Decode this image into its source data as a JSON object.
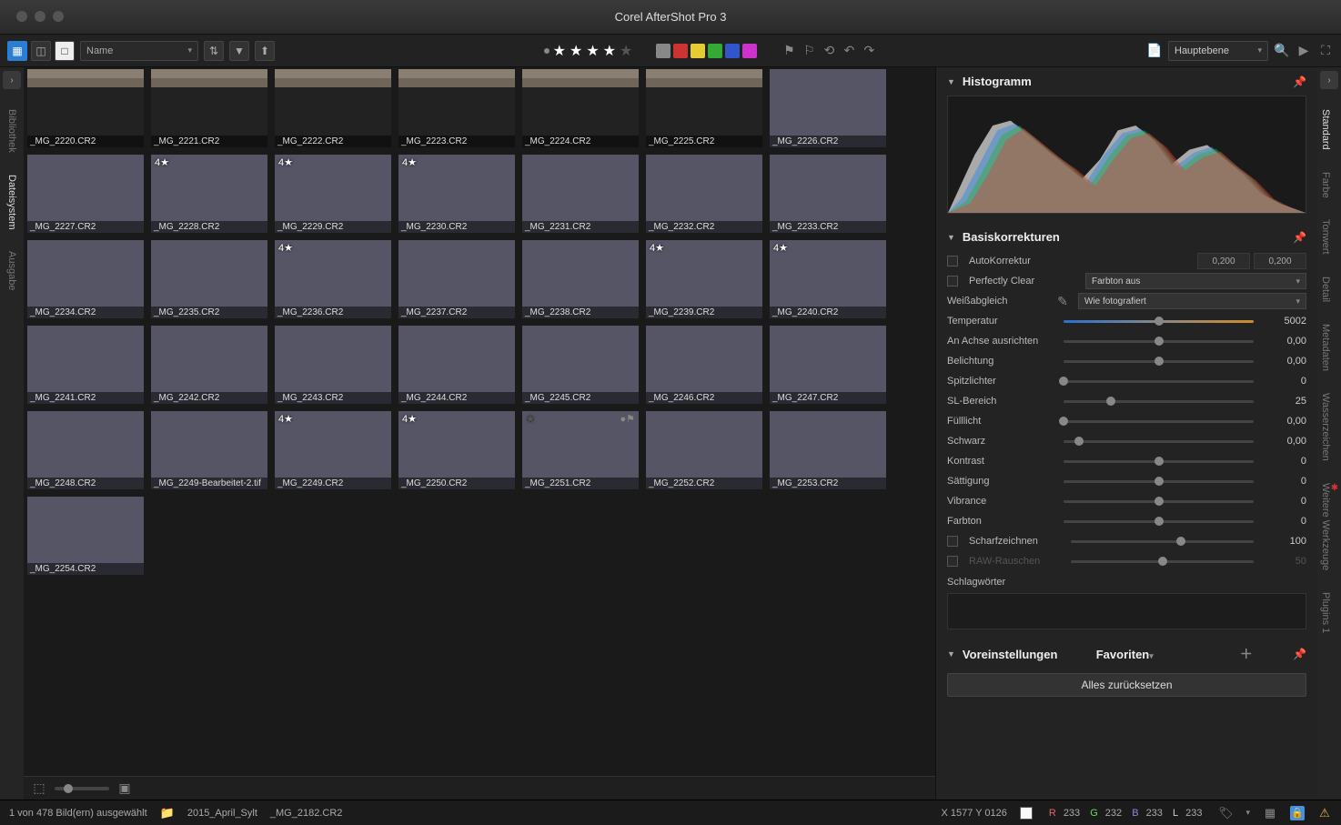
{
  "app": {
    "title": "Corel AfterShot Pro 3"
  },
  "toolbar": {
    "sort_by": "Name",
    "layer": "Hauptebene",
    "label_colors": [
      "#888888",
      "#cc3333",
      "#e6cc33",
      "#33aa33",
      "#3355cc",
      "#cc33cc"
    ]
  },
  "left_tabs": [
    "Bibliothek",
    "Dateisystem",
    "Ausgabe"
  ],
  "left_active": 1,
  "right_tabs": [
    "Standard",
    "Farbe",
    "Tonwert",
    "Detail",
    "Metadaten",
    "Wasserzeichen",
    "Weitere Werkzeuge",
    "Plugins 1"
  ],
  "right_active": 0,
  "thumbnails": {
    "row0": [
      {
        "fn": "_MG_2220.CR2"
      },
      {
        "fn": "_MG_2221.CR2"
      },
      {
        "fn": "_MG_2222.CR2"
      },
      {
        "fn": "_MG_2223.CR2"
      },
      {
        "fn": "_MG_2224.CR2"
      },
      {
        "fn": "_MG_2225.CR2"
      }
    ],
    "rows": [
      [
        {
          "fn": "_MG_2226.CR2",
          "cls": "imgsky1"
        },
        {
          "fn": "_MG_2227.CR2",
          "cls": "imgsky1"
        },
        {
          "fn": "_MG_2228.CR2",
          "rating": "4★",
          "cls": "imgsky1"
        },
        {
          "fn": "_MG_2229.CR2",
          "rating": "4★",
          "cls": "imgsky1"
        },
        {
          "fn": "_MG_2230.CR2",
          "rating": "4★",
          "cls": "imgsky1"
        },
        {
          "fn": "_MG_2231.CR2",
          "cls": "imgsky1"
        }
      ],
      [
        {
          "fn": "_MG_2232.CR2",
          "cls": "imgsky2"
        },
        {
          "fn": "_MG_2233.CR2",
          "cls": "imgsky2"
        },
        {
          "fn": "_MG_2234.CR2",
          "cls": "imgsky2"
        },
        {
          "fn": "_MG_2235.CR2",
          "cls": "imgsky2"
        },
        {
          "fn": "_MG_2236.CR2",
          "rating": "4★",
          "cls": "imgsky2"
        },
        {
          "fn": "_MG_2237.CR2",
          "cls": "imgsky2"
        }
      ],
      [
        {
          "fn": "_MG_2238.CR2",
          "cls": "imgsky3"
        },
        {
          "fn": "_MG_2239.CR2",
          "rating": "4★",
          "cls": "imgsky3"
        },
        {
          "fn": "_MG_2240.CR2",
          "rating": "4★",
          "cls": "imgsky3"
        },
        {
          "fn": "_MG_2241.CR2",
          "cls": "imgsky3"
        },
        {
          "fn": "_MG_2242.CR2",
          "cls": "imgsky3"
        },
        {
          "fn": "_MG_2243.CR2",
          "cls": "imgsky3"
        }
      ],
      [
        {
          "fn": "_MG_2244.CR2",
          "cls": "imgsky4"
        },
        {
          "fn": "_MG_2245.CR2",
          "cls": "imgsky4"
        },
        {
          "fn": "_MG_2246.CR2",
          "cls": "imgsky4"
        },
        {
          "fn": "_MG_2247.CR2",
          "cls": "imgsky4"
        },
        {
          "fn": "_MG_2248.CR2",
          "cls": "imgsky4"
        },
        {
          "fn": "_MG_2249-Bearbeitet-2.tif",
          "cls": "imgsky4"
        }
      ],
      [
        {
          "fn": "_MG_2249.CR2",
          "rating": "4★",
          "cls": "imgsky5"
        },
        {
          "fn": "_MG_2250.CR2",
          "rating": "4★",
          "cls": "imgsky5"
        },
        {
          "fn": "_MG_2251.CR2",
          "flag": true,
          "star_dim": true,
          "cls": "imgsky5"
        },
        {
          "fn": "_MG_2252.CR2",
          "cls": "imgsky5"
        },
        {
          "fn": "_MG_2253.CR2",
          "cls": "imgsky5"
        },
        {
          "fn": "_MG_2254.CR2",
          "cls": "imgsky5"
        }
      ]
    ]
  },
  "panel": {
    "histogram_title": "Histogramm",
    "basic_title": "Basiskorrekturen",
    "autokorrektur": "AutoKorrektur",
    "autok_v1": "0,200",
    "autok_v2": "0,200",
    "perfectly_clear": "Perfectly Clear",
    "farbton_dd": "Farbton aus",
    "wb_label": "Weißabgleich",
    "wb_dd": "Wie fotografiert",
    "sliders": [
      {
        "label": "Temperatur",
        "value": "5002",
        "pos": 50,
        "temp": true
      },
      {
        "label": "An Achse ausrichten",
        "value": "0,00",
        "pos": 50
      },
      {
        "label": "Belichtung",
        "value": "0,00",
        "pos": 50,
        "full": true
      },
      {
        "label": "Spitzlichter",
        "value": "0",
        "pos": 0
      },
      {
        "label": "SL-Bereich",
        "value": "25",
        "pos": 25
      },
      {
        "label": "Fülllicht",
        "value": "0,00",
        "pos": 0
      },
      {
        "label": "Schwarz",
        "value": "0,00",
        "pos": 8
      },
      {
        "label": "Kontrast",
        "value": "0",
        "pos": 50
      },
      {
        "label": "Sättigung",
        "value": "0",
        "pos": 50
      },
      {
        "label": "Vibrance",
        "value": "0",
        "pos": 50
      },
      {
        "label": "Farbton",
        "value": "0",
        "pos": 50
      }
    ],
    "scharfzeichnen": {
      "label": "Scharfzeichnen",
      "value": "100",
      "pos": 60
    },
    "raw_rauschen": {
      "label": "RAW-Rauschen",
      "value": "50",
      "pos": 50
    },
    "schlagworter": "Schlagwörter",
    "presets_title": "Voreinstellungen",
    "presets_dd": "Favoriten",
    "reset": "Alles zurücksetzen"
  },
  "status": {
    "selection": "1 von 478 Bild(ern) ausgewählt",
    "folder": "2015_April_Sylt",
    "filename": "_MG_2182.CR2",
    "coords": "X 1577  Y 0126",
    "R_lbl": "R",
    "R": "233",
    "G_lbl": "G",
    "G": "232",
    "B_lbl": "B",
    "B": "233",
    "L_lbl": "L",
    "L": "233"
  }
}
